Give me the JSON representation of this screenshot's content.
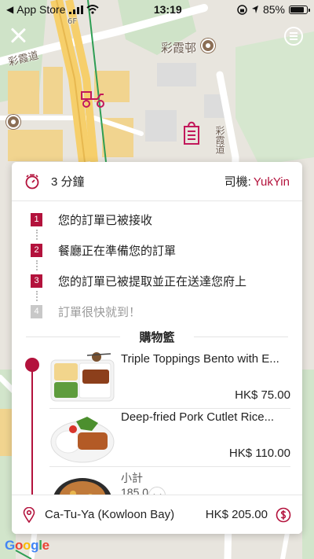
{
  "status_bar": {
    "back_app": "App Store",
    "time": "13:19",
    "battery": "85%",
    "battery_level": 0.85
  },
  "map": {
    "labels": [
      "彩霞邨",
      "彩霞道",
      "彩霞道",
      "6F"
    ],
    "attribution": [
      "G",
      "o",
      "o",
      "g",
      "l",
      "e"
    ],
    "icons": [
      "rider-icon",
      "restaurant-bag-icon"
    ]
  },
  "order": {
    "eta": "3 分鐘",
    "driver_label": "司機:",
    "driver_name": "YukYin",
    "steps": [
      {
        "number": "1",
        "text": "您的訂單已被接收",
        "done": true
      },
      {
        "number": "2",
        "text": "餐廳正在準備您的訂單",
        "done": true
      },
      {
        "number": "3",
        "text": "您的訂單已被提取並正在送達您府上",
        "done": true
      },
      {
        "number": "4",
        "text": "訂單很快就到！",
        "done": false
      }
    ],
    "basket_title": "購物籃",
    "items": [
      {
        "name": "Triple Toppings Bento with E...",
        "price": "HK$ 75.00"
      },
      {
        "name": "Deep-fried Pork Cutlet Rice...",
        "price": "HK$ 110.00"
      }
    ],
    "subtotal_label": "小計",
    "subtotal_value": "185.0",
    "restaurant": "Ca-Tu-Ya (Kowloon Bay)",
    "total": "HK$ 205.00"
  },
  "colors": {
    "accent": "#b3123c",
    "pending": "#c8c8c8"
  }
}
